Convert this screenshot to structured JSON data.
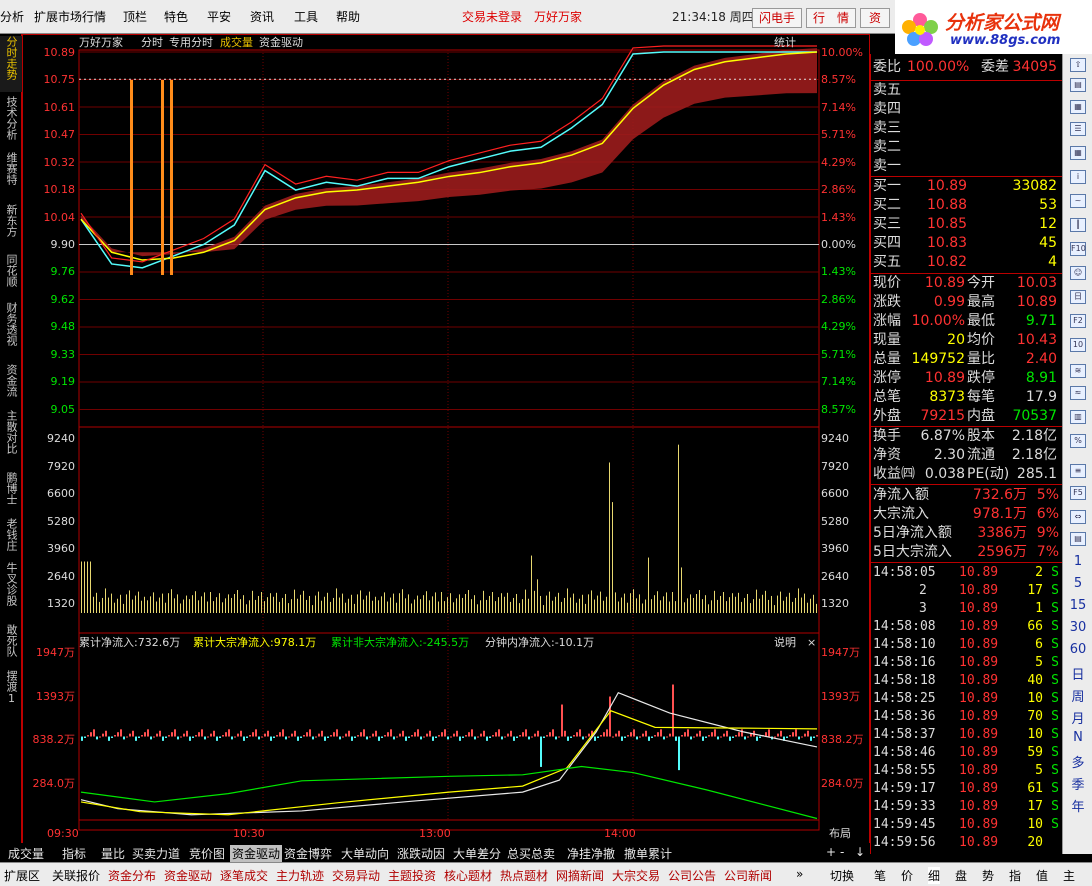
{
  "menu": {
    "items": [
      "分析",
      "扩展市场行情",
      "顶栏",
      "特色",
      "平安",
      "资讯",
      "工具",
      "帮助"
    ],
    "login_status": "交易未登录",
    "broker": "万好万家",
    "clock": "21:34:18 周四",
    "buttons": [
      "闪电手",
      "行　情",
      "资"
    ]
  },
  "logo": {
    "title": "分析家公式网",
    "url": "www.88gs.com"
  },
  "left_tabs": [
    "分时走势",
    "技术分析",
    "维赛特",
    "新东方",
    "同花顺",
    "财务透视",
    "资金流",
    "主散对比",
    "鹏博士",
    "老钱庄",
    "牛叉诊股",
    "敢死队",
    "摆渡1"
  ],
  "chart_header": {
    "stock": "万好万家",
    "items": [
      "分时",
      "专用分时",
      "成交量",
      "资金驱动"
    ],
    "stat_button": "统计"
  },
  "price_axis": {
    "left": [
      "10.89",
      "10.75",
      "10.61",
      "10.47",
      "10.32",
      "10.18",
      "10.04",
      "9.90",
      "9.76",
      "9.62",
      "9.48",
      "9.33",
      "9.19",
      "9.05"
    ],
    "right": [
      "10.00%",
      "8.57%",
      "7.14%",
      "5.71%",
      "4.29%",
      "2.86%",
      "1.43%",
      "0.00%",
      "1.43%",
      "2.86%",
      "4.29%",
      "5.71%",
      "7.14%",
      "8.57%"
    ]
  },
  "volume_axis": [
    "9240",
    "7920",
    "6600",
    "5280",
    "3960",
    "2640",
    "1320"
  ],
  "flow_header": {
    "cum_net_inflow": "累计净流入:732.6万",
    "cum_block_inflow": "累计大宗净流入:978.1万",
    "cum_nonblock_inflow": "累计非大宗净流入:-245.5万",
    "minute_inflow": "分钟内净流入:-10.1万",
    "note": "说明"
  },
  "flow_axis": [
    "1947万",
    "1393万",
    "838.2万",
    "284.0万"
  ],
  "time_axis": [
    "09:30",
    "10:30",
    "13:00",
    "14:00"
  ],
  "layout_btn": "布局",
  "quote": {
    "weibi": {
      "label": "委比",
      "value": "100.00%",
      "diff_label": "委差",
      "diff": "34095"
    },
    "sells": [
      "卖五",
      "卖四",
      "卖三",
      "卖二",
      "卖一"
    ],
    "buys": [
      {
        "label": "买一",
        "price": "10.89",
        "vol": "33082"
      },
      {
        "label": "买二",
        "price": "10.88",
        "vol": "53"
      },
      {
        "label": "买三",
        "price": "10.85",
        "vol": "12"
      },
      {
        "label": "买四",
        "price": "10.83",
        "vol": "45"
      },
      {
        "label": "买五",
        "price": "10.82",
        "vol": "4"
      }
    ],
    "stats": [
      {
        "l1": "现价",
        "v1": "10.89",
        "l2": "今开",
        "v2": "10.03"
      },
      {
        "l1": "涨跌",
        "v1": "0.99",
        "l2": "最高",
        "v2": "10.89"
      },
      {
        "l1": "涨幅",
        "v1": "10.00%",
        "l2": "最低",
        "v2": "9.71"
      },
      {
        "l1": "现量",
        "v1": "20",
        "l2": "均价",
        "v2": "10.43"
      },
      {
        "l1": "总量",
        "v1": "149752",
        "l2": "量比",
        "v2": "2.40"
      },
      {
        "l1": "涨停",
        "v1": "10.89",
        "l2": "跌停",
        "v2": "8.91"
      },
      {
        "l1": "总笔",
        "v1": "8373",
        "l2": "每笔",
        "v2": "17.9"
      },
      {
        "l1": "外盘",
        "v1": "79215",
        "l2": "内盘",
        "v2": "70537"
      }
    ],
    "fund": [
      {
        "l1": "换手",
        "v1": "6.87%",
        "l2": "股本",
        "v2": "2.18亿"
      },
      {
        "l1": "净资",
        "v1": "2.30",
        "l2": "流通",
        "v2": "2.18亿"
      },
      {
        "l1": "收益㈣",
        "v1": "0.038",
        "l2": "PE(动)",
        "v2": "285.1"
      }
    ],
    "flows": [
      {
        "label": "净流入额",
        "value": "732.6万",
        "pct": "5%"
      },
      {
        "label": "大宗流入",
        "value": "978.1万",
        "pct": "6%"
      },
      {
        "label": "5日净流入额",
        "value": "3386万",
        "pct": "9%"
      },
      {
        "label": "5日大宗流入",
        "value": "2596万",
        "pct": "7%"
      }
    ]
  },
  "trades": [
    {
      "time": "14:58:05",
      "price": "10.89",
      "vol": "2",
      "dir": "S"
    },
    {
      "time": "",
      "price": "10.89",
      "vol": "17",
      "dir": "S",
      "idx": "2"
    },
    {
      "time": "",
      "price": "10.89",
      "vol": "1",
      "dir": "S",
      "idx": "3"
    },
    {
      "time": "14:58:08",
      "price": "10.89",
      "vol": "66",
      "dir": "S"
    },
    {
      "time": "14:58:10",
      "price": "10.89",
      "vol": "6",
      "dir": "S"
    },
    {
      "time": "14:58:16",
      "price": "10.89",
      "vol": "5",
      "dir": "S"
    },
    {
      "time": "14:58:18",
      "price": "10.89",
      "vol": "40",
      "dir": "S"
    },
    {
      "time": "14:58:25",
      "price": "10.89",
      "vol": "10",
      "dir": "S"
    },
    {
      "time": "14:58:36",
      "price": "10.89",
      "vol": "70",
      "dir": "S"
    },
    {
      "time": "14:58:37",
      "price": "10.89",
      "vol": "10",
      "dir": "S"
    },
    {
      "time": "14:58:46",
      "price": "10.89",
      "vol": "59",
      "dir": "S"
    },
    {
      "time": "14:58:55",
      "price": "10.89",
      "vol": "5",
      "dir": "S"
    },
    {
      "time": "14:59:17",
      "price": "10.89",
      "vol": "61",
      "dir": "S"
    },
    {
      "time": "14:59:33",
      "price": "10.89",
      "vol": "17",
      "dir": "S"
    },
    {
      "time": "14:59:45",
      "price": "10.89",
      "vol": "10",
      "dir": "S"
    },
    {
      "time": "14:59:56",
      "price": "10.89",
      "vol": "20",
      "dir": ""
    }
  ],
  "side_periods": [
    "1",
    "5",
    "15",
    "30",
    "60",
    "日",
    "周",
    "月",
    "N",
    "多",
    "季",
    "年"
  ],
  "bottom_tabs": [
    "成交量",
    "指标",
    "量比",
    "买卖力道",
    "竞价图",
    "资金驱动",
    "资金博弈",
    "大单动向",
    "涨跌动因",
    "大单差分",
    "总买总卖",
    "净挂净撤",
    "撤单累计"
  ],
  "status_tabs": [
    "扩展区",
    "关联报价",
    "资金分布",
    "资金驱动",
    "逐笔成交",
    "主力轨迹",
    "交易异动",
    "主题投资",
    "核心题材",
    "热点题材",
    "网摘新闻",
    "大宗交易",
    "公司公告",
    "公司新闻"
  ],
  "status_right": "切换",
  "right_tabs": [
    "笔",
    "价",
    "细",
    "盘",
    "势",
    "指",
    "值",
    "主"
  ],
  "colors": {
    "up": "#ff3232",
    "down": "#00e600",
    "yellow": "#ffff00",
    "cyan": "#54fcfc",
    "frame": "#b00000"
  },
  "chart_data": {
    "type": "line",
    "price": {
      "x": [
        "09:30",
        "09:40",
        "09:50",
        "10:00",
        "10:10",
        "10:20",
        "10:30",
        "10:40",
        "10:50",
        "11:00",
        "11:10",
        "11:20",
        "11:30",
        "13:10",
        "13:20",
        "13:30",
        "13:40",
        "13:50",
        "14:00",
        "14:10",
        "14:20",
        "14:30",
        "14:40",
        "14:50",
        "15:00"
      ],
      "values": [
        10.03,
        9.8,
        9.78,
        9.84,
        9.9,
        10.0,
        10.28,
        10.18,
        10.22,
        10.2,
        10.24,
        10.24,
        10.3,
        10.34,
        10.38,
        10.4,
        10.5,
        10.62,
        10.88,
        10.89,
        10.89,
        10.89,
        10.89,
        10.89,
        10.89
      ],
      "avg": [
        10.03,
        9.86,
        9.82,
        9.83,
        9.86,
        9.92,
        10.08,
        10.14,
        10.17,
        10.18,
        10.2,
        10.22,
        10.25,
        10.27,
        10.3,
        10.32,
        10.36,
        10.42,
        10.6,
        10.72,
        10.8,
        10.84,
        10.86,
        10.88,
        10.89
      ],
      "ylim": [
        8.91,
        10.89
      ],
      "prev_close": 9.9
    },
    "volume": {
      "ylim": [
        0,
        9240
      ]
    },
    "flow": {
      "series_names": [
        "累计净流入",
        "累计大宗净流入",
        "累计非大宗净流入"
      ],
      "ylim": [
        -270,
        1947
      ]
    }
  }
}
